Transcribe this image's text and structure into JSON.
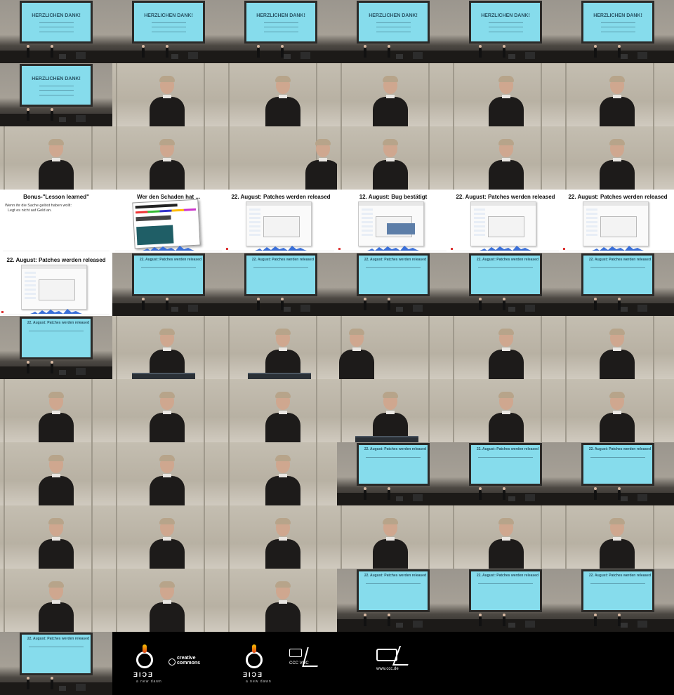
{
  "slide_texts": {
    "thanks_title": "HERZLICHEN DANK!",
    "patches_title": "22. August: Patches werden released",
    "lesson_title": "Bonus-\"Lesson learned\"",
    "lesson_bullet_1": "Wenn ihr die Sache gelöst haben wollt:",
    "lesson_bullet_2": "Legt es nicht auf Geld an.",
    "damage_title": "Wer den Schaden hat ...",
    "confirmed_title": "12. August: Bug bestätigt"
  },
  "credits": {
    "logo_word": "ƎIƆƎ",
    "logo_tag": "a new dawn",
    "cc_label_1": "creative",
    "cc_label_2": "commons",
    "voc_label": "CCC VOC",
    "ccc_site": "www.ccc.de"
  },
  "colors": {
    "projector_screen": "#86dcec",
    "stage_wall": "#a6a096",
    "background": "#000000"
  },
  "tiles": [
    "stage-thanks",
    "stage-thanks",
    "stage-thanks",
    "stage-thanks",
    "stage-thanks",
    "stage-thanks",
    "stage-thanks",
    "speaker",
    "speaker",
    "speaker",
    "speaker",
    "speaker",
    "speaker",
    "speaker",
    "speaker-edge",
    "speaker",
    "speaker",
    "speaker",
    "slide-lesson",
    "slide-damage",
    "slide-patches",
    "slide-confirmed",
    "slide-patches",
    "slide-patches",
    "slide-patches",
    "stage-patch",
    "stage-patch",
    "stage-patch",
    "stage-patch",
    "stage-patch",
    "stage-patch",
    "speaker-podium",
    "speaker-podium",
    "speaker-side",
    "speaker",
    "speaker",
    "speaker",
    "speaker",
    "speaker",
    "speaker-podium",
    "speaker",
    "speaker",
    "speaker",
    "speaker",
    "speaker",
    "stage-patch",
    "stage-patch",
    "stage-patch",
    "speaker",
    "speaker",
    "speaker",
    "speaker",
    "speaker",
    "speaker",
    "speaker",
    "speaker",
    "speaker",
    "stage-patch",
    "stage-patch",
    "stage-patch",
    "stage-patch",
    "credits-logo",
    "credits-voc",
    "credits-ccc",
    "black",
    "black"
  ]
}
